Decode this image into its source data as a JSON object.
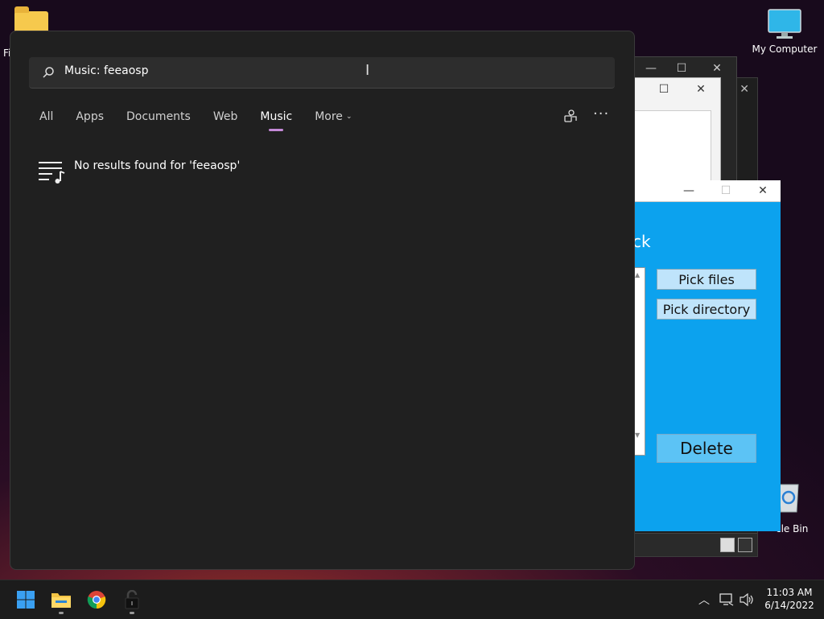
{
  "desktop": {
    "icons": [
      {
        "label": "Fi"
      },
      {
        "label": "My Computer"
      },
      {
        "label": "cle Bin"
      }
    ]
  },
  "search": {
    "query": "Music: feeaosp",
    "tabs": [
      {
        "label": "All"
      },
      {
        "label": "Apps"
      },
      {
        "label": "Documents"
      },
      {
        "label": "Web"
      },
      {
        "label": "Music"
      },
      {
        "label": "More"
      }
    ],
    "active_tab": "Music",
    "no_results": "No results found for 'feeaosp'"
  },
  "app_window": {
    "heading_fragment": "ck",
    "pick_files": "Pick files",
    "pick_directory": "Pick directory",
    "delete": "Delete"
  },
  "taskbar": {
    "time": "11:03 AM",
    "date": "6/14/2022"
  },
  "colors": {
    "app_blue": "#0ca2ee",
    "accent_underline": "#c58ad8",
    "panel_bg": "#202020"
  }
}
